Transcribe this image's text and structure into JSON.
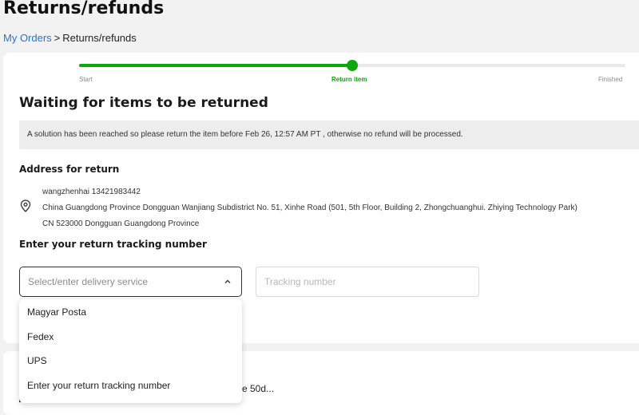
{
  "page": {
    "title": "Returns/refunds"
  },
  "breadcrumb": {
    "link": "My Orders",
    "separator": ">",
    "current": "Returns/refunds"
  },
  "progress": {
    "fraction_complete": 0.5,
    "active_color": "#0aa80a",
    "steps": [
      {
        "label": "Start",
        "state": "done"
      },
      {
        "label": "Return item",
        "state": "active"
      },
      {
        "label": "Finished",
        "state": "pending"
      }
    ]
  },
  "status": {
    "heading": "Waiting for items to be returned",
    "notice": "A solution has been reached so please return the item before Feb 26, 12:57 AM PT , otherwise no refund will be processed."
  },
  "address": {
    "heading": "Address for return",
    "icon": "location-pin-icon",
    "lines": [
      "wangzhenhai 13421983442",
      "China Guangdong Province Dongguan Wanjiang Subdistrict No. 51, Xinhe Road (501, 5th Floor, Building 2, Zhongchuanghui. Zhiying Technology Park)",
      "CN 523000 Dongguan Guangdong Province"
    ]
  },
  "tracking": {
    "heading": "Enter your return tracking number",
    "delivery_placeholder": "Select/enter delivery service",
    "number_placeholder": "Tracking number",
    "dropdown_options": [
      "Magyar Posta",
      "Fedex",
      "UPS",
      "Enter your return tracking number"
    ]
  },
  "lower_card": {
    "partial_text": "e 50d..."
  }
}
